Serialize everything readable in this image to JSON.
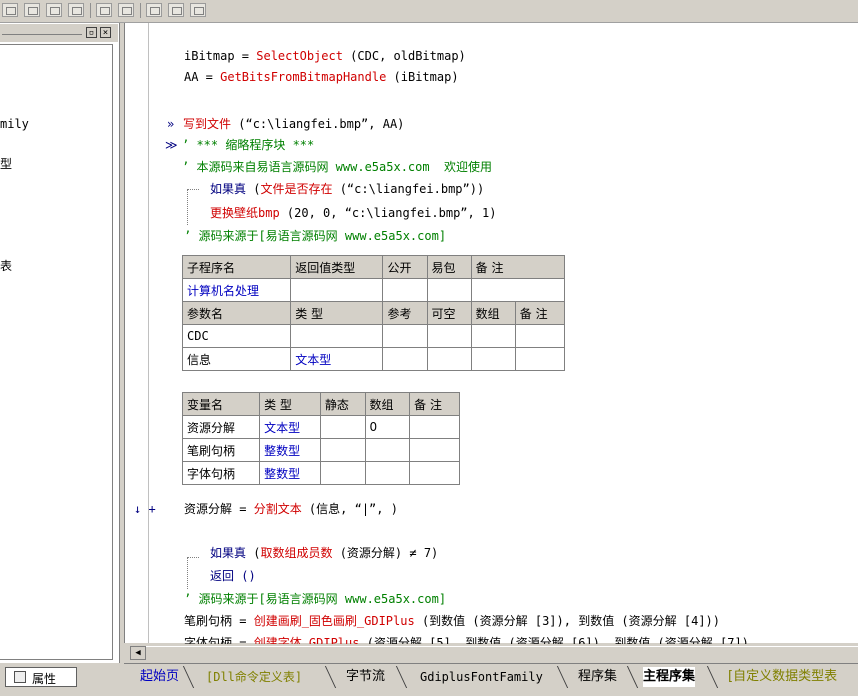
{
  "left_panel": {
    "tree_fragments": [
      "mily",
      "型",
      "表"
    ],
    "props_tab_label": "属性"
  },
  "code_top": [
    {
      "pre": "iBitmap = ",
      "fn": "SelectObject",
      "post": " (CDC, oldBitmap)"
    },
    {
      "pre": "AA = ",
      "fn": "GetBitsFromBitmapHandle",
      "post": " (iBitmap)"
    }
  ],
  "write_file": {
    "fn": "写到文件",
    "args": " (“c:\\liangfei.bmp”, AA)"
  },
  "collapsed_block": "’ *** 缩略程序块 ***",
  "comment_source": "’ 本源码来自易语言源码网 www.e5a5x.com  欢迎使用",
  "if_block_1": {
    "kw": "如果真",
    "cond_fn": "文件是否存在",
    "cond_args": " (“c:\\liangfei.bmp”))",
    "body_fn": "更换壁纸bmp",
    "body_args": " (20, 0, “c:\\liangfei.bmp”, 1)",
    "comment": "’ 源码来源于[易语言源码网 www.e5a5x.com]"
  },
  "sub_table": {
    "header": [
      "子程序名",
      "返回值类型",
      "公开",
      "易包",
      "备 注"
    ],
    "name": "计算机名处理",
    "param_header": [
      "参数名",
      "类 型",
      "参考",
      "可空",
      "数组",
      "备 注"
    ],
    "params": [
      {
        "name": "CDC",
        "type": ""
      },
      {
        "name": "信息",
        "type": "文本型"
      }
    ]
  },
  "var_table": {
    "header": [
      "变量名",
      "类 型",
      "静态",
      "数组",
      "备 注"
    ],
    "rows": [
      {
        "name": "资源分解",
        "type": "文本型",
        "array": "0"
      },
      {
        "name": "笔刷句柄",
        "type": "整数型",
        "array": ""
      },
      {
        "name": "字体句柄",
        "type": "整数型",
        "array": ""
      }
    ]
  },
  "split_line": {
    "markers": "↓ +",
    "lhs": "资源分解 = ",
    "fn": "分割文本",
    "args": " (信息, “|”, )"
  },
  "if_block_2": {
    "kw": "如果真",
    "cond_fn": "取数组成员数",
    "cond_args": " (资源分解) ≠ 7)",
    "body": "返回 ()",
    "comment": "’ 源码来源于[易语言源码网 www.e5a5x.com]"
  },
  "brush_line": {
    "lhs": "笔刷句柄 = ",
    "fn": "创建画刷_固色画刷_GDIPlus",
    "args": " (到数值 (资源分解 [3]), 到数值 (资源分解 [4]))"
  },
  "font_line_partial": {
    "lhs": "字体句柄 = ",
    "fn": "创建字体_GDIPlus",
    "args": " (资源分解 [5], 到数值 (资源分解 [6]), 到数值 (资源分解 [7]),"
  },
  "tabs": [
    "起始页",
    "[Dll命令定义表]",
    "字节流",
    "GdiplusFontFamily",
    "程序集",
    "主程序集",
    "[自定义数据类型表"
  ]
}
